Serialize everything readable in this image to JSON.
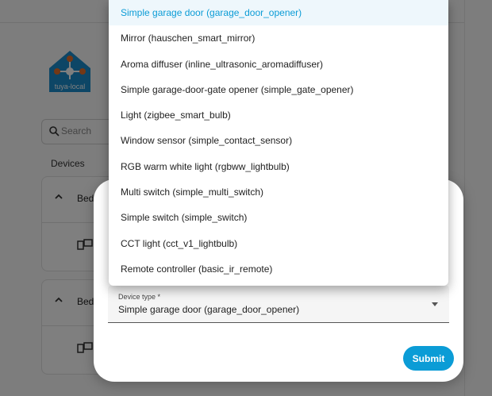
{
  "background": {
    "search_placeholder": "Search",
    "devices_label": "Devices",
    "device_cards": [
      {
        "name": "Bed"
      },
      {
        "name": "Bed"
      }
    ]
  },
  "dialog": {
    "device_type_label": "Device type *",
    "device_type_value": "Simple garage door (garage_door_opener)",
    "submit_label": "Submit"
  },
  "dropdown": {
    "options": [
      "Simple garage door (garage_door_opener)",
      "Mirror (hauschen_smart_mirror)",
      "Aroma diffuser (inline_ultrasonic_aromadiffuser)",
      "Simple garage-door-gate opener (simple_gate_opener)",
      "Light (zigbee_smart_bulb)",
      "Window sensor (simple_contact_sensor)",
      "RGB warm white light (rgbww_lightbulb)",
      "Multi switch (simple_multi_switch)",
      "Simple switch (simple_switch)",
      "CCT light (cct_v1_lightbulb)",
      "Remote controller (basic_ir_remote)"
    ],
    "selected_index": 0
  },
  "colors": {
    "accent": "#0b9cd6",
    "logo_orange": "#e8702a",
    "logo_blue": "#1a8ccc"
  },
  "logo_text": "tuya-local"
}
